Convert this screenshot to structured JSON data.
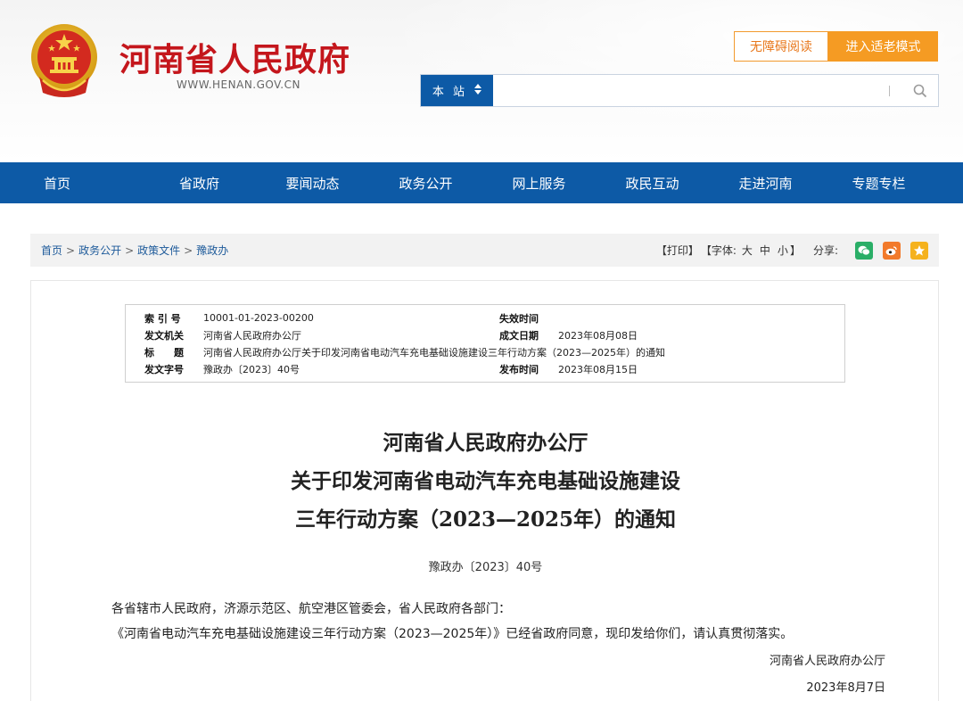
{
  "header": {
    "site_name": "河南省人民政府",
    "site_url": "WWW.HENAN.GOV.CN",
    "accessibility_label": "无障碍阅读",
    "elder_mode_label": "进入适老模式",
    "search": {
      "scope_label": "本 站",
      "placeholder": ""
    }
  },
  "nav": {
    "items": [
      "首页",
      "省政府",
      "要闻动态",
      "政务公开",
      "网上服务",
      "政民互动",
      "走进河南",
      "专题专栏"
    ]
  },
  "breadcrumb": {
    "items": [
      "首页",
      "政务公开",
      "政策文件",
      "豫政办"
    ],
    "separator": ">"
  },
  "tools": {
    "print": "【打印】",
    "font_prefix": "【字体:",
    "font_large": "大",
    "font_medium": "中",
    "font_small": "小",
    "font_suffix": "】",
    "share_label": "分享:"
  },
  "meta": {
    "index_label": "索 引 号",
    "index_value": "10001-01-2023-00200",
    "expire_label": "失效时间",
    "expire_value": "",
    "issuer_label": "发文机关",
    "issuer_value": "河南省人民政府办公厅",
    "created_label": "成文日期",
    "created_value": "2023年08月08日",
    "title_label": "标　　题",
    "title_value": "河南省人民政府办公厅关于印发河南省电动汽车充电基础设施建设三年行动方案（2023—2025年）的通知",
    "docno_label": "发文字号",
    "docno_value": "豫政办〔2023〕40号",
    "published_label": "发布时间",
    "published_value": "2023年08月15日"
  },
  "document": {
    "title_line1": "河南省人民政府办公厅",
    "title_line2": "关于印发河南省电动汽车充电基础设施建设",
    "title_line3": "三年行动方案（2023—2025年）的通知",
    "doc_number": "豫政办〔2023〕40号",
    "salutation": "各省辖市人民政府，济源示范区、航空港区管委会，省人民政府各部门：",
    "body": "《河南省电动汽车充电基础设施建设三年行动方案（2023—2025年）》已经省政府同意，现印发给你们，请认真贯彻落实。",
    "signer": "河南省人民政府办公厅",
    "date": "2023年8月7日"
  },
  "colors": {
    "brand_red": "#c4161c",
    "nav_blue": "#0d5aa6",
    "elder_orange": "#f59b23",
    "wechat_green": "#2aae67",
    "weibo_orange": "#f27a2b",
    "favorite_yellow": "#f5b21d"
  },
  "icons": {
    "emblem": "national-emblem-icon",
    "search": "search-icon",
    "scope_toggle": "sort-arrows-icon",
    "wechat": "wechat-icon",
    "weibo": "weibo-icon",
    "favorite": "star-icon"
  }
}
